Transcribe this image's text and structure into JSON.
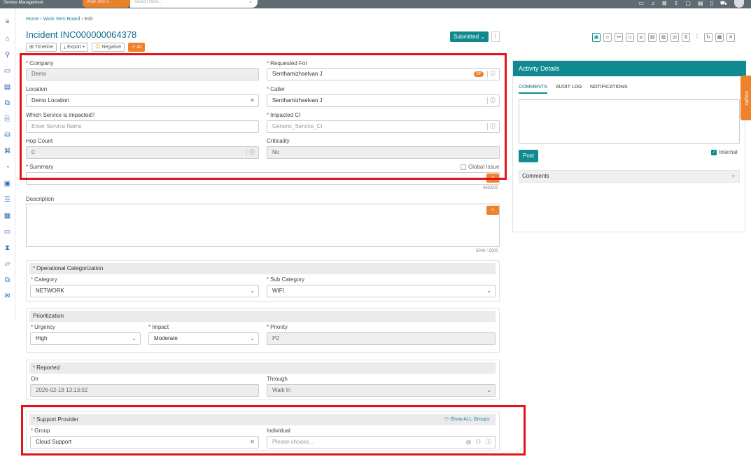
{
  "app": {
    "brand": "Service Management",
    "top_button": "Work Item #",
    "search_placeholder": "Search Here..."
  },
  "breadcrumb": {
    "home": "Home",
    "board": "Work Item Board",
    "current": "Edit"
  },
  "header": {
    "title": "Incident  INC000000064378",
    "timeline": "Timeline",
    "export": "Export ▾",
    "sentiment": "Negative",
    "ai": "AI",
    "status": "Submitted ⌄"
  },
  "icons": {
    "sidebar": [
      "menu-icon",
      "home-icon",
      "incident-icon",
      "service-icon",
      "document-icon",
      "change-icon",
      "release-icon",
      "database-icon",
      "command-icon",
      "report-icon",
      "inbox-icon",
      "list-icon",
      "calendar-icon",
      "monitor-icon",
      "hourglass-icon",
      "laptop-icon",
      "copy-icon",
      "mail-icon"
    ],
    "toolbar": [
      "screen-icon",
      "chat-icon",
      "link-icon",
      "tag-icon",
      "attach-icon",
      "clipboard-icon",
      "board-icon",
      "eye-icon",
      "hourglass-icon",
      "more-icon",
      "refresh-icon",
      "save-icon",
      "close-icon"
    ]
  },
  "form": {
    "company": {
      "label": "Company",
      "value": "Demo"
    },
    "requested_for": {
      "label": "Requested For",
      "value": "Senthamizhselvan J",
      "badge": "VIP"
    },
    "location": {
      "label": "Location",
      "value": "Demo Location"
    },
    "caller": {
      "label": "Caller",
      "value": "Senthamizhselvan J"
    },
    "service": {
      "label": "Which Service is impacted?",
      "placeholder": "Enter Service Name"
    },
    "impacted_ci": {
      "label": "Impacted CI",
      "value": "Generic_Service_CI"
    },
    "hop_count": {
      "label": "Hop Count",
      "value": "0"
    },
    "criticality": {
      "label": "Criticality",
      "value": "No"
    },
    "summary": {
      "label": "Summary",
      "global_issue": "Global Issue",
      "count": "483/500"
    },
    "description": {
      "label": "Description",
      "count": "5000 / 5000"
    }
  },
  "operational": {
    "heading": "Operational Categorization",
    "category": {
      "label": "Category",
      "value": "NETWORK"
    },
    "sub_category": {
      "label": "Sub Category",
      "value": "WIFI"
    }
  },
  "prioritization": {
    "heading": "Prioritization",
    "urgency": {
      "label": "Urgency",
      "value": "High"
    },
    "impact": {
      "label": "Impact",
      "value": "Moderate"
    },
    "priority": {
      "label": "Priority",
      "value": "P2"
    }
  },
  "reported": {
    "heading": "Reported",
    "on": {
      "label": "On",
      "value": "2026-02-18 13:13:02"
    },
    "through": {
      "label": "Through",
      "value": "Walk In"
    }
  },
  "support": {
    "heading": "Support Provider",
    "show_all": "Show ALL Groups",
    "group": {
      "label": "Group",
      "value": "Cloud Support"
    },
    "individual": {
      "label": "Individual",
      "placeholder": "Please choose..."
    }
  },
  "activity": {
    "heading": "Activity Details",
    "tabs": [
      "COMMENTS",
      "AUDIT LOG",
      "NOTIFICATIONS"
    ],
    "post": "Post",
    "internal": "Internal",
    "comments": "Comments",
    "insights": "Insights"
  },
  "colors": {
    "teal": "#0f8a8e",
    "orange": "#f0822c",
    "highlight": "#e3131a"
  }
}
